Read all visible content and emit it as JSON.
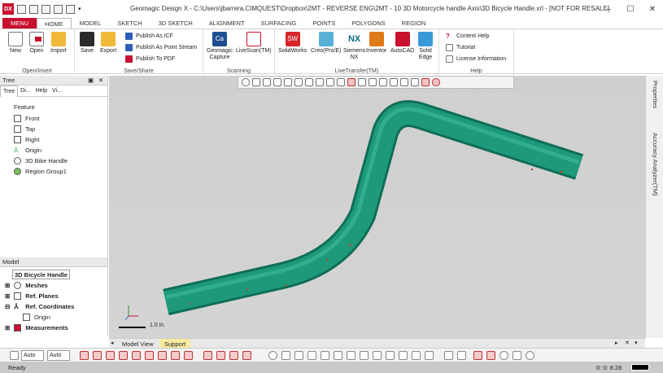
{
  "window": {
    "app_icon": "DX",
    "title": "Geomagic Design X - C:\\Users\\jbarrera.CIMQUEST\\Dropbox\\2MT - REVERSE ENG\\2MT - 10 3D Motorcycle handle Axis\\3D Bicycle Handle.xrl - [NOT FOR RESALE]",
    "min": "–",
    "max": "☐",
    "close": "✕"
  },
  "tabs": [
    "MENU",
    "HOME",
    "MODEL",
    "SKETCH",
    "3D SKETCH",
    "ALIGNMENT",
    "SURFACING",
    "POINTS",
    "POLYGONS",
    "REGION"
  ],
  "ribbon": {
    "open_insert": {
      "title": "Open/Insert",
      "new": "New",
      "open": "Open",
      "import": "Import"
    },
    "save_share": {
      "title": "Save/Share",
      "save": "Save",
      "export": "Export",
      "publish_icf": "Publish As ICF",
      "publish_stream": "Publish As Point Stream",
      "publish_pdf": "Publish To PDF"
    },
    "scanning": {
      "title": "Scanning",
      "capture_line1": "Geomagic",
      "capture_line2": "Capture",
      "livescan": "LiveScan(TM)"
    },
    "livetransfer": {
      "title": "LiveTransfer(TM)",
      "solidworks": "SolidWorks",
      "creo": "Creo(Pro/E)",
      "siemens_line1": "Siemens",
      "siemens_line2": "NX",
      "inventor": "Inventor",
      "autocad": "AutoCAD",
      "solidedge_line1": "Solid",
      "solidedge_line2": "Edge"
    },
    "help": {
      "title": "Help",
      "context": "Context Help",
      "tutorial": "Tutorial",
      "license": "License Information"
    }
  },
  "tree_panel": {
    "title": "Tree",
    "pin": "▣",
    "close": "✕",
    "tabs": [
      "Tree",
      "Di...",
      "Help",
      "Vi..."
    ],
    "feature_header": "Feature",
    "features": [
      "Front",
      "Top",
      "Right",
      "Origin",
      "3D Bike Handle",
      "Region Group1"
    ]
  },
  "model_panel": {
    "header": "Model",
    "root": "3D Bicycle Handle",
    "items": [
      "Meshes",
      "Ref. Planes",
      "Ref. Coordinates",
      "Origin",
      "Measurements"
    ]
  },
  "viewport": {
    "scale_label": "1.0 in."
  },
  "right_panel": {
    "properties": "Properties",
    "accuracy": "Accuracy Analyzer(TM)"
  },
  "view_tabs": [
    "Model View",
    "Support"
  ],
  "bottom_toolbar": {
    "select_1": "Auto",
    "select_2": "Auto"
  },
  "status": {
    "left": "Ready",
    "time": "0: 0: 8.28"
  },
  "colors": {
    "brand_red": "#c8102e",
    "mesh_green": "#1e9a7a",
    "viewport_gray": "#d0d0d0"
  }
}
